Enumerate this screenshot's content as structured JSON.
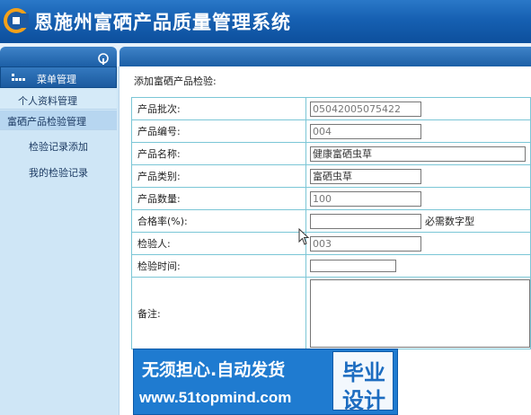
{
  "header": {
    "title": "恩施州富硒产品质量管理系统"
  },
  "sidebar": {
    "menu_header": "菜单管理",
    "items": [
      {
        "label": "个人资料管理"
      },
      {
        "label": "富硒产品检验管理"
      }
    ],
    "sub_items": [
      {
        "label": "检验记录添加"
      },
      {
        "label": "我的检验记录"
      }
    ]
  },
  "form": {
    "title": "添加富硒产品检验:",
    "fields": {
      "batch": {
        "label": "产品批次:",
        "value": "05042005075422"
      },
      "code": {
        "label": "产品编号:",
        "value": "004"
      },
      "name": {
        "label": "产品名称:",
        "value": "健康富硒虫草"
      },
      "category": {
        "label": "产品类别:",
        "value": "富硒虫草"
      },
      "quantity": {
        "label": "产品数量:",
        "value": "100"
      },
      "pass_rate": {
        "label": "合格率(%):",
        "value": "",
        "hint": "必需数字型"
      },
      "inspector": {
        "label": "检验人:",
        "value": "003"
      },
      "check_time": {
        "label": "检验时间:",
        "value": ""
      },
      "remark": {
        "label": "备注:",
        "value": ""
      }
    }
  },
  "watermark": {
    "line1": "无须担心.自动发货",
    "line2": "www.51topmind.com",
    "box_line1": "毕业",
    "box_line2": "设计"
  },
  "colors": {
    "header_blue": "#1660b2",
    "sidebar_bg": "#cfe6f6",
    "table_border": "#7bc6d6",
    "watermark_blue": "#1f7bd0"
  }
}
